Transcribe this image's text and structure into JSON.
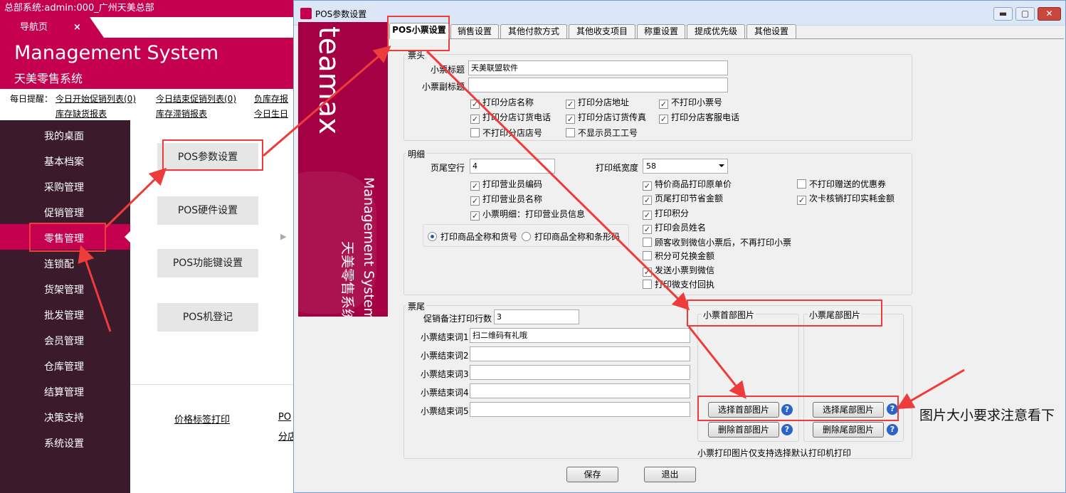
{
  "bg": {
    "title": "总部系统:admin:000_广州天美总部",
    "nav_tab": "导航页",
    "nav_tab_close": "×",
    "brand_en": "Management System",
    "brand_cn": "天美零售系统",
    "reminder_label": "每日提醒：",
    "reminders": [
      "今日开始促销列表(0)",
      "今日结束促销列表(0)",
      "负库存报",
      "库存缺货报表",
      "库存滞销报表",
      "今日生日"
    ],
    "sidebar": [
      "我的桌面",
      "基本档案",
      "采购管理",
      "促销管理",
      "零售管理",
      "连锁配",
      "货架管理",
      "批发管理",
      "会员管理",
      "仓库管理",
      "结算管理",
      "决策支持",
      "系统设置"
    ],
    "menu": [
      "POS参数设置",
      "POS硬件设置",
      "POS功能键设置",
      "POS机登记"
    ],
    "bottom_links": [
      "价格标签打印",
      "PO",
      "分店"
    ],
    "arrow_glyph": "▶"
  },
  "dialog": {
    "title": "POS参数设置",
    "win_min": "▬",
    "win_max": "▢",
    "win_close": "✕",
    "banner_logo": "teamax",
    "banner_en": "Management System",
    "banner_cn": "天美零售系统",
    "tabs": [
      "POS小票设置",
      "销售设置",
      "其他付款方式",
      "其他收支项目",
      "称重设置",
      "提成优先级",
      "其他设置"
    ],
    "header": {
      "title": "票头",
      "ticket_title_label": "小票标题",
      "ticket_title_value": "天美联盟软件",
      "ticket_subtitle_label": "小票副标题",
      "ticket_subtitle_value": "",
      "checks": [
        {
          "label": "打印分店名称",
          "checked": true
        },
        {
          "label": "打印分店地址",
          "checked": true
        },
        {
          "label": "不打印小票号",
          "checked": true
        },
        {
          "label": "打印分店订货电话",
          "checked": true
        },
        {
          "label": "打印分店订货传真",
          "checked": true
        },
        {
          "label": "打印分店客服电话",
          "checked": true
        },
        {
          "label": "不打印分店店号",
          "checked": false
        },
        {
          "label": "不显示员工工号",
          "checked": false
        }
      ]
    },
    "detail": {
      "title": "明细",
      "footer_blank_label": "页尾空行",
      "footer_blank_value": "4",
      "paper_width_label": "打印纸宽度",
      "paper_width_value": "58",
      "checks_left": [
        {
          "label": "打印营业员编码",
          "checked": true
        },
        {
          "label": "打印营业员名称",
          "checked": true
        },
        {
          "label": "小票明细：打印营业员信息",
          "checked": true
        }
      ],
      "radios": [
        {
          "label": "打印商品全称和货号",
          "selected": true
        },
        {
          "label": "打印商品全称和条形码",
          "selected": false
        }
      ],
      "checks_mid": [
        {
          "label": "特价商品打印原单价",
          "checked": true
        },
        {
          "label": "页尾打印节省金额",
          "checked": true
        },
        {
          "label": "打印积分",
          "checked": true
        },
        {
          "label": "打印会员姓名",
          "checked": true
        },
        {
          "label": "顾客收到微信小票后，不再打印小票",
          "checked": false
        },
        {
          "label": "积分可兑换金额",
          "checked": false
        },
        {
          "label": "发送小票到微信",
          "checked": true
        },
        {
          "label": "打印微支付回执",
          "checked": false
        }
      ],
      "checks_right": [
        {
          "label": "不打印赠送的优惠券",
          "checked": false
        },
        {
          "label": "次卡核销打印实耗金额",
          "checked": true
        }
      ]
    },
    "footer": {
      "title": "票尾",
      "promo_lines_label": "促销备注打印行数",
      "promo_lines_value": "3",
      "end_labels": [
        "小票结束词1",
        "小票结束词2",
        "小票结束词3",
        "小票结束词4",
        "小票结束词5"
      ],
      "end_values": [
        "扫二维码有礼哦",
        "",
        "",
        "",
        ""
      ],
      "head_image_title": "小票首部图片",
      "tail_image_title": "小票尾部图片",
      "choose_head": "选择首部图片",
      "choose_tail": "选择尾部图片",
      "delete_head": "删除首部图片",
      "delete_tail": "删除尾部图片",
      "help_glyph": "?",
      "print_note": "小票打印图片仅支持选择默认打印机打印"
    },
    "save": "保存",
    "exit": "退出"
  },
  "annotation": {
    "note": "图片大小要求注意看下",
    "color": "#ee3b3b"
  }
}
